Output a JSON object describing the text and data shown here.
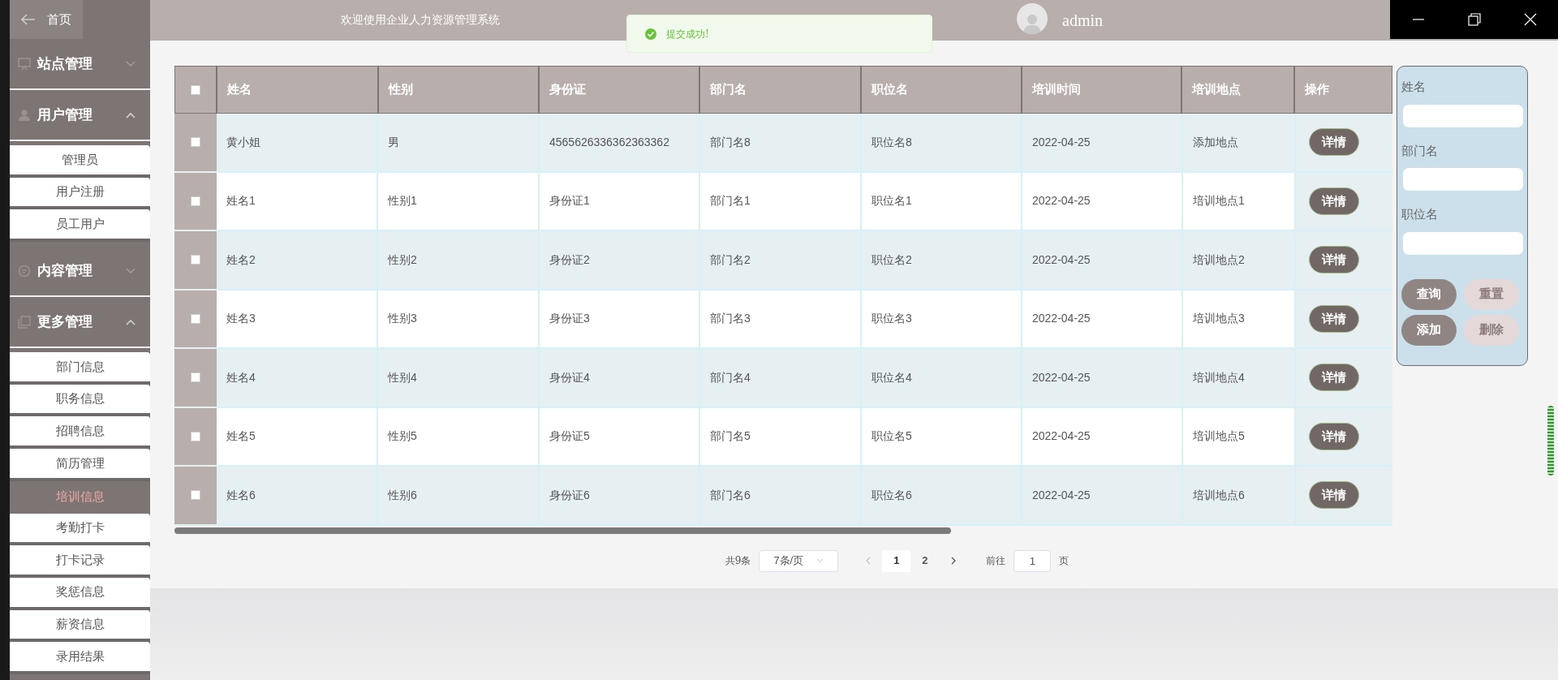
{
  "sidebar": {
    "home": {
      "label": "首页"
    },
    "groups": [
      {
        "label": "站点管理",
        "expanded": false
      },
      {
        "label": "用户管理",
        "expanded": true,
        "children": [
          {
            "label": "管理员",
            "selected": false
          },
          {
            "label": "用户注册",
            "selected": false
          },
          {
            "label": "员工用户",
            "selected": false
          }
        ]
      },
      {
        "label": "内容管理",
        "expanded": false
      },
      {
        "label": "更多管理",
        "expanded": true,
        "children": [
          {
            "label": "部门信息",
            "selected": false
          },
          {
            "label": "职务信息",
            "selected": false
          },
          {
            "label": "招聘信息",
            "selected": false
          },
          {
            "label": "简历管理",
            "selected": false
          },
          {
            "label": "培训信息",
            "selected": true
          },
          {
            "label": "考勤打卡",
            "selected": false
          },
          {
            "label": "打卡记录",
            "selected": false
          },
          {
            "label": "奖惩信息",
            "selected": false
          },
          {
            "label": "薪资信息",
            "selected": false
          },
          {
            "label": "录用结果",
            "selected": false
          }
        ]
      }
    ]
  },
  "header": {
    "title": "欢迎使用企业人力资源管理系统",
    "user": "admin"
  },
  "toast": {
    "message": "提交成功!"
  },
  "table": {
    "select_all_checked": false,
    "columns": [
      "姓名",
      "性别",
      "身份证",
      "部门名",
      "职位名",
      "培训时间",
      "培训地点",
      "操作"
    ],
    "rows": [
      {
        "checked": false,
        "cells": [
          "黄小姐",
          "男",
          "4565626336362363362",
          "部门名8",
          "职位名8",
          "2022-04-25",
          "添加地点"
        ],
        "action": "详情"
      },
      {
        "checked": false,
        "cells": [
          "姓名1",
          "性别1",
          "身份证1",
          "部门名1",
          "职位名1",
          "2022-04-25",
          "培训地点1"
        ],
        "action": "详情"
      },
      {
        "checked": false,
        "cells": [
          "姓名2",
          "性别2",
          "身份证2",
          "部门名2",
          "职位名2",
          "2022-04-25",
          "培训地点2"
        ],
        "action": "详情"
      },
      {
        "checked": false,
        "cells": [
          "姓名3",
          "性别3",
          "身份证3",
          "部门名3",
          "职位名3",
          "2022-04-25",
          "培训地点3"
        ],
        "action": "详情"
      },
      {
        "checked": false,
        "cells": [
          "姓名4",
          "性别4",
          "身份证4",
          "部门名4",
          "职位名4",
          "2022-04-25",
          "培训地点4"
        ],
        "action": "详情"
      },
      {
        "checked": false,
        "cells": [
          "姓名5",
          "性别5",
          "身份证5",
          "部门名5",
          "职位名5",
          "2022-04-25",
          "培训地点5"
        ],
        "action": "详情"
      },
      {
        "checked": false,
        "cells": [
          "姓名6",
          "性别6",
          "身份证6",
          "部门名6",
          "职位名6",
          "2022-04-25",
          "培训地点6"
        ],
        "action": "详情"
      }
    ]
  },
  "search": {
    "fields": [
      {
        "label": "姓名"
      },
      {
        "label": "部门名"
      },
      {
        "label": "职位名"
      }
    ],
    "buttons": [
      {
        "label": "查询",
        "kind": "primary"
      },
      {
        "label": "重置",
        "kind": "muted"
      },
      {
        "label": "添加",
        "kind": "primary"
      },
      {
        "label": "删除",
        "kind": "muted"
      }
    ]
  },
  "pagination": {
    "total": "共9条",
    "page_size": "7条/页",
    "pages": [
      {
        "label": "1",
        "selected": true
      },
      {
        "label": "2",
        "selected": false
      }
    ],
    "goto_label": "前往",
    "goto_value": "1",
    "goto_suffix": "页"
  }
}
